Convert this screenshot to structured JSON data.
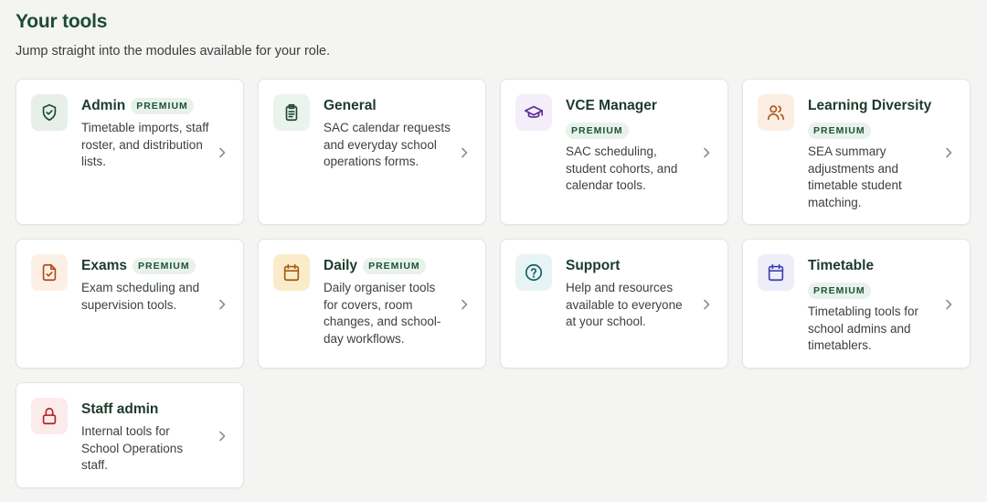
{
  "header": {
    "title": "Your tools",
    "subtitle": "Jump straight into the modules available for your role."
  },
  "tools": [
    {
      "name": "Admin",
      "badge": "PREMIUM",
      "badge_inline": true,
      "description": "Timetable imports, staff roster, and distribution lists.",
      "icon": "shield-icon",
      "icon_bg": "#e6efe9",
      "icon_color": "#1d4a33"
    },
    {
      "name": "General",
      "badge": "",
      "description": "SAC calendar requests and everyday school operations forms.",
      "icon": "clipboard-icon",
      "icon_bg": "#eaf3ec",
      "icon_color": "#1d4a33"
    },
    {
      "name": "VCE Manager",
      "badge": "PREMIUM",
      "badge_inline": false,
      "description": "SAC scheduling, student cohorts, and calendar tools.",
      "icon": "graduation-cap-icon",
      "icon_bg": "#f3eef9",
      "icon_color": "#5b2a91"
    },
    {
      "name": "Learning Diversity",
      "badge": "PREMIUM",
      "badge_inline": false,
      "description": "SEA summary adjustments and timetable student matching.",
      "icon": "users-icon",
      "icon_bg": "#fbeee3",
      "icon_color": "#b0571c"
    },
    {
      "name": "Exams",
      "badge": "PREMIUM",
      "badge_inline": true,
      "description": "Exam scheduling and supervision tools.",
      "icon": "file-check-icon",
      "icon_bg": "#fcf0e6",
      "icon_color": "#b04a1c"
    },
    {
      "name": "Daily",
      "badge": "PREMIUM",
      "badge_inline": true,
      "description": "Daily organiser tools for covers, room changes, and school-day workflows.",
      "icon": "calendar-icon",
      "icon_bg": "#fbecc9",
      "icon_color": "#a55a12"
    },
    {
      "name": "Support",
      "badge": "",
      "description": "Help and resources available to everyone at your school.",
      "icon": "help-circle-icon",
      "icon_bg": "#e8f4f4",
      "icon_color": "#155e6b"
    },
    {
      "name": "Timetable",
      "badge": "PREMIUM",
      "badge_inline": false,
      "description": "Timetabling tools for school admins and timetablers.",
      "icon": "calendar-icon",
      "icon_bg": "#eeeefb",
      "icon_color": "#3d3fb0"
    },
    {
      "name": "Staff admin",
      "badge": "",
      "description": "Internal tools for School Operations staff.",
      "icon": "lock-icon",
      "icon_bg": "#fcebeb",
      "icon_color": "#b3232b"
    }
  ]
}
